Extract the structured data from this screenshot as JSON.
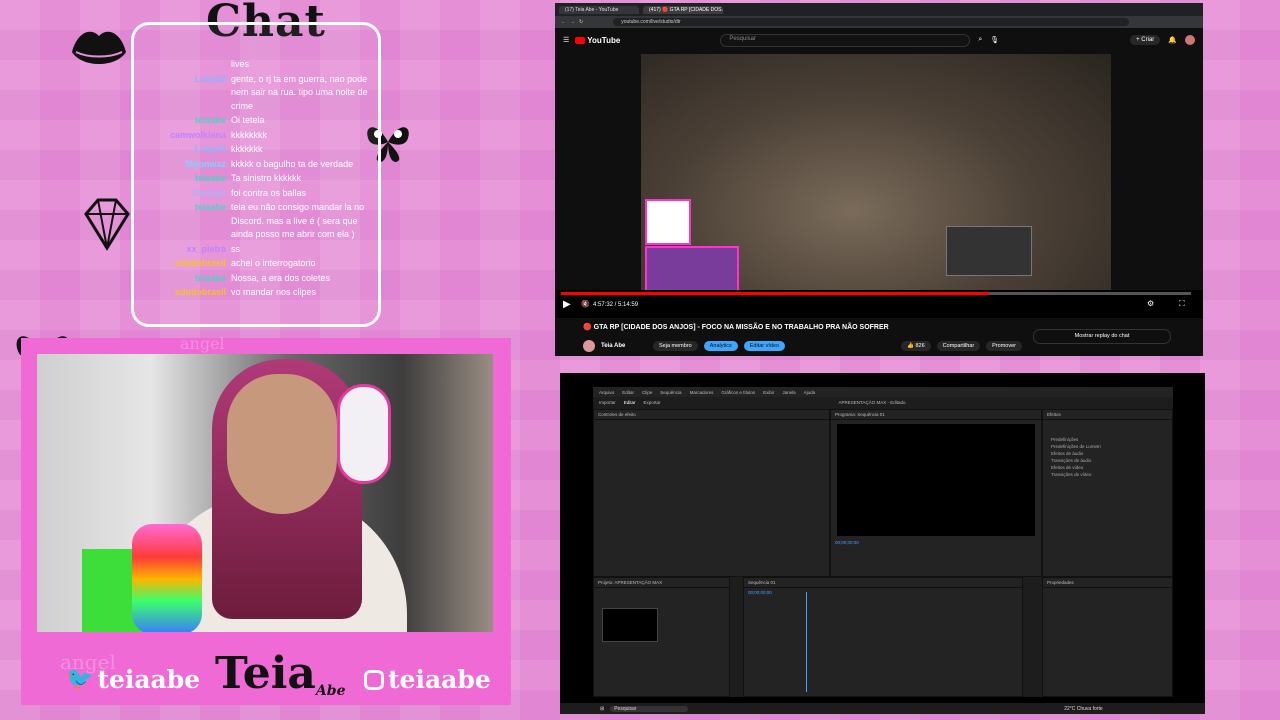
{
  "overlay": {
    "chat_title": "Chat",
    "brand_name": "Teia",
    "brand_sub": "Abe",
    "twitter_handle": "teiaabe",
    "instagram_handle": "teiaabe",
    "watermark": "angel"
  },
  "chat": {
    "messages": [
      {
        "user": "",
        "text": "lives",
        "color": "#ffffff"
      },
      {
        "user": "Luby29",
        "text": "gente, o rj ta em guerra, nao pode nem sair na rua. tipo uma noite de crime",
        "color": "#8fb4ff"
      },
      {
        "user": "teiaabe",
        "text": "Oi teteia",
        "color": "#4fd1c5"
      },
      {
        "user": "camwolkiana",
        "text": "kkkkkkkk",
        "color": "#c084fc"
      },
      {
        "user": "Luby29",
        "text": "kkkkkkk",
        "color": "#8fb4ff"
      },
      {
        "user": "Moonwaz",
        "text": "kkkkk o bagulho ta de verdade",
        "color": "#7dd3fc"
      },
      {
        "user": "teiaabe",
        "text": "Ta sinistro kkkkkk",
        "color": "#4fd1c5"
      },
      {
        "user": "Carolyn",
        "text": "foi contra os ballas",
        "color": "#a5b4fc"
      },
      {
        "user": "teiaabe",
        "text": "teia eu não consigo mandar la no Discord. mas a live é ( sera que ainda posso me abrir com ela )",
        "color": "#4fd1c5"
      },
      {
        "user": "xx_pietra",
        "text": "ss",
        "color": "#c084fc"
      },
      {
        "user": "edudobrasil",
        "text": "achei o interrogatorio",
        "color": "#fbbf24"
      },
      {
        "user": "teiaabe",
        "text": "Nossa, a era dos coletes",
        "color": "#4fd1c5"
      },
      {
        "user": "edudobrasil",
        "text": "vo mandar nos clipes",
        "color": "#fbbf24"
      }
    ]
  },
  "youtube": {
    "tab1": "(17) Teia Abe - YouTube",
    "tab2": "(417) 🔴 GTA RP [CIDADE DOS ANJOS]",
    "url": "youtube.com/live/studio/dtr",
    "logo": "YouTube",
    "search_placeholder": "Pesquisar",
    "create_label": "+ Criar",
    "time": "4:57:32 / 5:14:59",
    "video_title": "🔴 GTA RP [CIDADE DOS ANJOS] - FOCO NA MISSÃO E NO TRABALHO PRA NÃO SOFRER",
    "channel_name": "Teia Abe",
    "join_label": "Seja membro",
    "analytics_label": "Analytics",
    "edit_label": "Editar vídeo",
    "likes": "826",
    "share_label": "Compartilhar",
    "promote_label": "Promover",
    "replay_label": "Mostrar replay do chat",
    "progress": 0.68
  },
  "premiere": {
    "menus": [
      "Arquivo",
      "Editar",
      "Clipe",
      "Sequência",
      "Marcadores",
      "Gráficos e títulos",
      "Exibir",
      "Janela",
      "Ajuda"
    ],
    "tabs": [
      "Importar",
      "Editar",
      "Exportar"
    ],
    "center_title": "APRESENTAÇÃO MAX - Editado",
    "source_panel": "Controles de efeito",
    "program_panel": "Programa: Sequência 01",
    "effects_panel": "Efeitos",
    "project_panel": "Projeto: APRESENTAÇÃO MAX",
    "timeline_panel": "Sequência 01",
    "timecode": "00;00;00;00",
    "properties_panel": "Propriedades",
    "folders": [
      "Predefinições",
      "Predefinições de Lumetri",
      "Efeitos de áudio",
      "Transições de áudio",
      "Efeitos de vídeo",
      "Transições de vídeo"
    ],
    "taskbar_search": "Pesquisar",
    "weather": "22°C Chuva forte"
  }
}
